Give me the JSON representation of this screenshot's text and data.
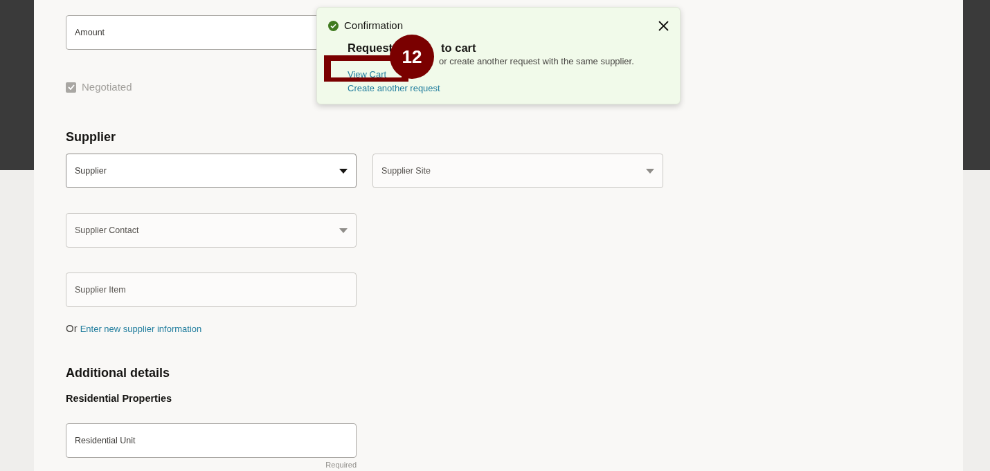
{
  "form": {
    "amount": {
      "placeholder": "Amount",
      "disabled": false
    },
    "negotiated": {
      "label": "Negotiated",
      "checked": true,
      "disabled": true
    },
    "sections": [
      {
        "title": "Supplier",
        "fields": [
          {
            "kind": "select",
            "placeholder": "Supplier",
            "disabled": false
          },
          {
            "kind": "select",
            "placeholder": "Supplier Site",
            "disabled": true
          },
          {
            "kind": "select",
            "placeholder": "Supplier Contact",
            "disabled": true
          },
          {
            "kind": "text",
            "placeholder": "Supplier Item",
            "disabled": true
          }
        ],
        "note": {
          "prefix": "Or",
          "link": "Enter new supplier information"
        }
      },
      {
        "title": "Additional details",
        "subtitle": "Residential Properties",
        "fields": [
          {
            "kind": "text",
            "placeholder": "Residential Unit",
            "disabled": false,
            "hint": "Required"
          }
        ]
      }
    ]
  },
  "toast": {
    "title": "Confirmation",
    "heading_parts": [
      "Request",
      "to cart"
    ],
    "message": "or create another request with the same supplier.",
    "links": [
      {
        "parts": [
          "View Cart"
        ]
      },
      {
        "parts": [
          "Create another request"
        ]
      }
    ]
  },
  "callout": {
    "number": "12"
  }
}
